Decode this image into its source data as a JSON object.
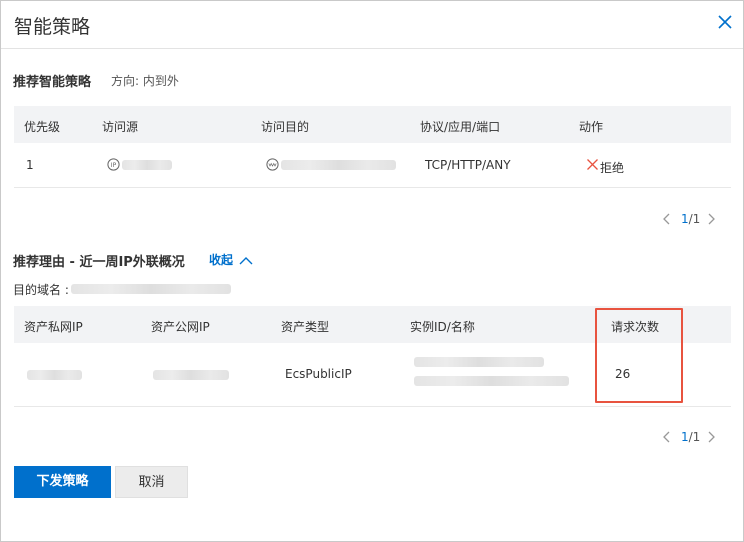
{
  "dialog": {
    "title": "智能策略",
    "close_icon": "close-icon"
  },
  "recommend": {
    "title": "推荐智能策略",
    "direction": "方向: 内到外",
    "columns": [
      "优先级",
      "访问源",
      "访问目的",
      "协议/应用/端口",
      "动作"
    ],
    "row": {
      "priority": "1",
      "protocol": "TCP/HTTP/ANY",
      "action": "拒绝",
      "source_icon": "ip-icon",
      "dest_icon": "www-icon"
    },
    "pager": {
      "current": "1",
      "total": "/1"
    }
  },
  "reason": {
    "title": "推荐理由 - 近一周IP外联概况",
    "collapse_label": "收起",
    "domain_label": "目的域名 :",
    "columns": [
      "资产私网IP",
      "资产公网IP",
      "资产类型",
      "实例ID/名称",
      "请求次数"
    ],
    "row": {
      "asset_type": "EcsPublicIP",
      "requests": "26"
    },
    "pager": {
      "current": "1",
      "total": "/1"
    }
  },
  "footer": {
    "submit_label": "下发策略",
    "cancel_label": "取消"
  },
  "colors": {
    "primary": "#0070cc",
    "highlight": "#e8533f",
    "deny": "#e8533f"
  }
}
